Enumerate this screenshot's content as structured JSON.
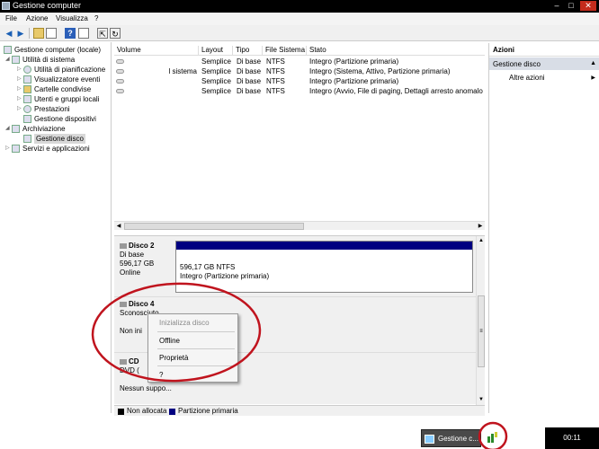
{
  "window": {
    "title": "Gestione computer",
    "minimize": "–",
    "maximize": "□",
    "close": "✕"
  },
  "menu": [
    "File",
    "Azione",
    "Visualizza",
    "?"
  ],
  "toolbar": {
    "icons": [
      "back-icon",
      "forward-icon",
      "up-folder-icon",
      "show-hide-tree-icon",
      "help-icon",
      "properties-icon",
      "export-icon",
      "refresh-icon",
      "help-topics-icon"
    ]
  },
  "tree": {
    "root": "Gestione computer (locale)",
    "items": [
      {
        "label": "Utilità di sistema",
        "icon": "tools-icon"
      },
      {
        "label": "Utilità di pianificazione",
        "icon": "clock-icon"
      },
      {
        "label": "Visualizzatore eventi",
        "icon": "event-viewer-icon"
      },
      {
        "label": "Cartelle condivise",
        "icon": "shared-folder-icon"
      },
      {
        "label": "Utenti e gruppi locali",
        "icon": "users-icon"
      },
      {
        "label": "Prestazioni",
        "icon": "performance-icon"
      },
      {
        "label": "Gestione dispositivi",
        "icon": "device-manager-icon"
      },
      {
        "label": "Archiviazione",
        "icon": "storage-icon"
      },
      {
        "label": "Gestione disco",
        "icon": "disk-icon"
      },
      {
        "label": "Servizi e applicazioni",
        "icon": "services-icon"
      }
    ]
  },
  "volumes": {
    "headers": [
      "Volume",
      "Layout",
      "Tipo",
      "File Sistema",
      "Stato"
    ],
    "rows": [
      [
        "",
        "Semplice",
        "Di base",
        "NTFS",
        "Integro (Partizione primaria)"
      ],
      [
        "l sistema",
        "Semplice",
        "Di base",
        "NTFS",
        "Integro (Sistema, Attivo, Partizione primaria)"
      ],
      [
        "",
        "Semplice",
        "Di base",
        "NTFS",
        "Integro (Partizione primaria)"
      ],
      [
        "",
        "Semplice",
        "Di base",
        "NTFS",
        "Integro (Avvio, File di paging, Dettagli arresto anomalo de"
      ]
    ]
  },
  "disks": {
    "disk2": {
      "name": "Disco 2",
      "type": "Di base",
      "size": "596,17 GB",
      "status": "Online",
      "partition_size": "596,17 GB NTFS",
      "partition_status": "Integro (Partizione primaria)"
    },
    "disk4": {
      "name": "Disco 4",
      "type": "Sconosciuto",
      "status": "Non ini"
    },
    "cd": {
      "name": "CD",
      "type": "DVD (",
      "status": "Nessun suppo..."
    }
  },
  "context_menu": {
    "items": [
      "Inizializza disco",
      "Offline",
      "Proprietà",
      "?"
    ]
  },
  "legend": {
    "items": [
      "Non allocata",
      "Partizione primaria"
    ],
    "colors": [
      "#000000",
      "#000080"
    ]
  },
  "actions": {
    "header": "Azioni",
    "section": "Gestione disco",
    "more": "Altre azioni"
  },
  "taskbar": {
    "task_label": "Gestione c...",
    "clock": "00:11"
  },
  "colors": {
    "accent": "#000080",
    "annotation": "#c0141e"
  }
}
